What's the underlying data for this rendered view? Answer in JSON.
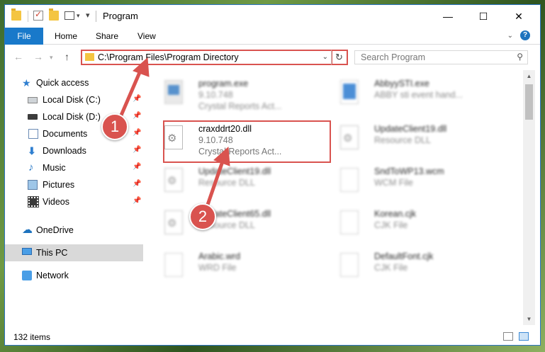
{
  "window": {
    "title": "Program",
    "controls": {
      "minimize": "—",
      "maximize": "☐",
      "close": "✕"
    }
  },
  "ribbon": {
    "tabs": [
      "File",
      "Home",
      "Share",
      "View"
    ],
    "help": "?"
  },
  "address_bar": {
    "path": "C:\\Program Files\\Program Directory",
    "refresh_icon": "↻"
  },
  "search": {
    "placeholder": "Search Program",
    "icon": "search-icon"
  },
  "sidebar": {
    "items": [
      {
        "label": "Quick access",
        "icon": "star-icon"
      },
      {
        "label": "Local Disk (C:)",
        "icon": "drive-icon",
        "pinned": true
      },
      {
        "label": "Local Disk (D:)",
        "icon": "drive-icon",
        "pinned": true
      },
      {
        "label": "Documents",
        "icon": "documents-icon",
        "pinned": true
      },
      {
        "label": "Downloads",
        "icon": "downloads-icon",
        "pinned": true
      },
      {
        "label": "Music",
        "icon": "music-icon",
        "pinned": true
      },
      {
        "label": "Pictures",
        "icon": "pictures-icon",
        "pinned": true
      },
      {
        "label": "Videos",
        "icon": "videos-icon",
        "pinned": true
      },
      {
        "label": "OneDrive",
        "icon": "onedrive-icon"
      },
      {
        "label": "This PC",
        "icon": "pc-icon",
        "selected": true
      },
      {
        "label": "Network",
        "icon": "network-icon"
      }
    ]
  },
  "files": [
    {
      "name": "program.exe",
      "line2": "9.10.748",
      "line3": "Crystal Reports Act...",
      "icon": "exe-icon"
    },
    {
      "name": "AbbyySTI.exe",
      "line2": "ABBY sti event hand...",
      "line3": "",
      "icon": "exe-icon"
    },
    {
      "name": "craxddrt20.dll",
      "line2": "9.10.748",
      "line3": "Crystal Reports Act...",
      "icon": "dll-icon",
      "highlighted": true
    },
    {
      "name": "UpdateClient19.dll",
      "line2": "Resource DLL",
      "line3": "",
      "icon": "dll-icon"
    },
    {
      "name": "UpdateClient19.dll",
      "line2": "Resource DLL",
      "line3": "",
      "icon": "dll-icon"
    },
    {
      "name": "SndToWP13.wcm",
      "line2": "WCM File",
      "line3": "",
      "icon": "file-icon"
    },
    {
      "name": "UpdateClient65.dll",
      "line2": "Resource DLL",
      "line3": "",
      "icon": "dll-icon"
    },
    {
      "name": "Korean.cjk",
      "line2": "CJK File",
      "line3": "",
      "icon": "file-icon"
    },
    {
      "name": "Arabic.wrd",
      "line2": "WRD File",
      "line3": "",
      "icon": "file-icon"
    },
    {
      "name": "DefaultFont.cjk",
      "line2": "CJK File",
      "line3": "",
      "icon": "file-icon"
    }
  ],
  "status": {
    "item_count": "132 items"
  },
  "annotations": {
    "step1": "1",
    "step2": "2",
    "color": "#d9534f"
  }
}
